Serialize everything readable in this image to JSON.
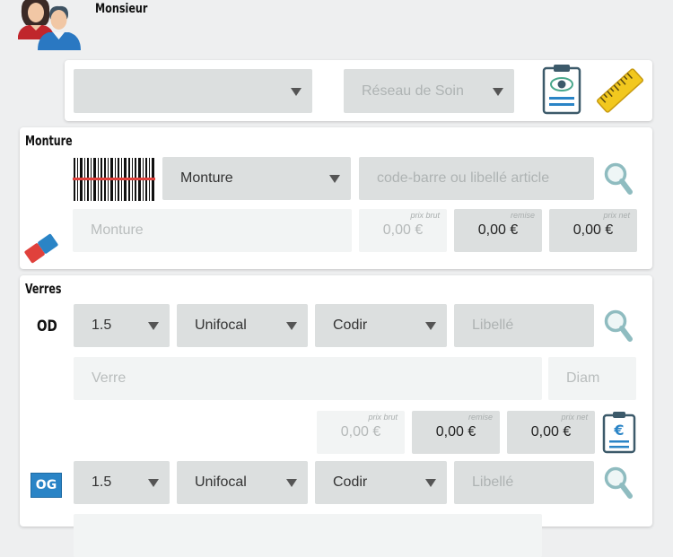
{
  "header": {
    "patient_name": "Monsieur",
    "avatar_icon": "couple-avatar-icon"
  },
  "top_bar": {
    "first_select_value": "",
    "network_select_label": "Réseau de Soin",
    "prescription_icon": "eye-prescription-icon",
    "measure_icon": "ruler-icon"
  },
  "monture": {
    "title": "Monture",
    "type_select": "Monture",
    "search_placeholder": "code-barre ou libellé article",
    "name_placeholder": "Monture",
    "prices": {
      "brut_label": "prix brut",
      "brut_value": "0,00 €",
      "remise_label": "remise",
      "remise_value": "0,00 €",
      "net_label": "prix net",
      "net_value": "0,00 €"
    }
  },
  "verres": {
    "title": "Verres",
    "od": {
      "label": "OD",
      "index": "1.5",
      "type": "Unifocal",
      "brand": "Codir",
      "libelle_placeholder": "Libellé",
      "verre_placeholder": "Verre",
      "diam_placeholder": "Diam",
      "prices": {
        "brut_label": "prix brut",
        "brut_value": "0,00 €",
        "remise_label": "remise",
        "remise_value": "0,00 €",
        "net_label": "prix net",
        "net_value": "0,00 €"
      }
    },
    "og": {
      "label": "OG",
      "index": "1.5",
      "type": "Unifocal",
      "brand": "Codir",
      "libelle_placeholder": "Libellé"
    }
  },
  "colors": {
    "background": "#eeeff0",
    "field": "#dcdfdf",
    "field_light": "#f2f4f4",
    "accent_blue": "#2a84c6",
    "accent_yellow": "#f2c81e",
    "accent_red": "#e0413c"
  }
}
